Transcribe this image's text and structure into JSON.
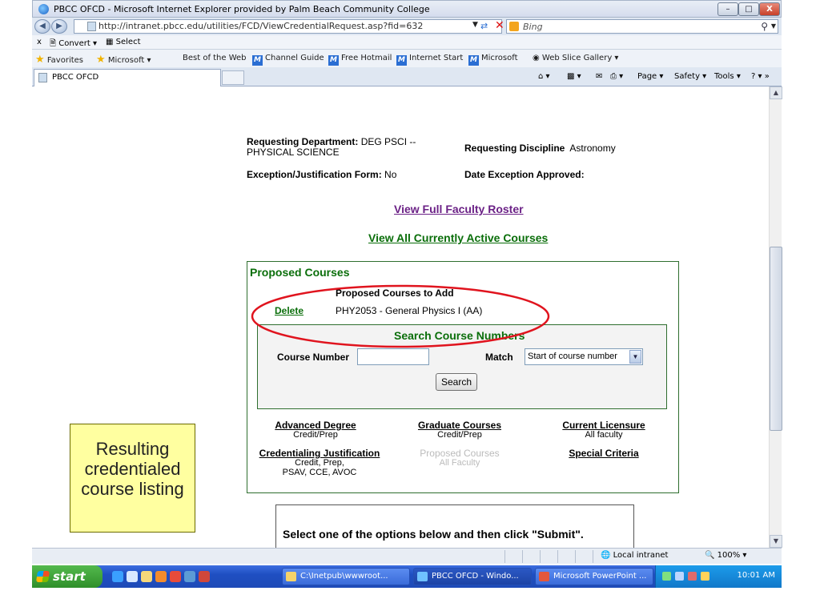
{
  "window": {
    "title": "PBCC OFCD - Microsoft Internet Explorer provided by Palm Beach Community College",
    "minimize": "–",
    "maximize": "□",
    "close": "X"
  },
  "address_bar": {
    "url": "http://intranet.pbcc.edu/utilities/FCD/ViewCredentialRequest.asp?fid=632",
    "search_provider": "Bing"
  },
  "command_bar": {
    "close_x": "x",
    "convert": "Convert",
    "select": "Select"
  },
  "favorites_bar": {
    "favorites": "Favorites",
    "items": [
      "Microsoft",
      "Best of the Web",
      "Channel Guide",
      "Free Hotmail",
      "Internet Start",
      "Microsoft",
      "Web Slice Gallery"
    ]
  },
  "tabs": {
    "active_tab": "PBCC OFCD",
    "tools": {
      "page": "Page",
      "safety": "Safety",
      "tools": "Tools",
      "help": "?"
    }
  },
  "request": {
    "requesting_department_label": "Requesting Department:",
    "requesting_department_value": "DEG PSCI --",
    "requesting_department_value2": "PHYSICAL SCIENCE",
    "requesting_discipline_label": "Requesting Discipline",
    "requesting_discipline_value": "Astronomy",
    "exception_label": "Exception/Justification Form:",
    "exception_value": "No",
    "date_exception_label": "Date Exception Approved:",
    "date_exception_value": ""
  },
  "links": {
    "view_roster": "View Full Faculty Roster",
    "view_courses": "View All Currently Active Courses"
  },
  "proposed": {
    "title": "Proposed Courses",
    "subheading": "Proposed Courses to Add",
    "delete_label": "Delete",
    "course": "PHY2053 - General Physics I (AA)"
  },
  "search": {
    "title": "Search Course Numbers",
    "course_number_label": "Course Number",
    "course_number_value": "",
    "match_label": "Match",
    "match_selected": "Start of course number",
    "search_button": "Search"
  },
  "credentials": [
    {
      "title": "Advanced Degree",
      "sub": [
        "Credit/Prep"
      ],
      "color": "#6b2186"
    },
    {
      "title": "Graduate Courses",
      "sub": [
        "Credit/Prep"
      ],
      "color": "#6b2186"
    },
    {
      "title": "Current Licensure",
      "sub": [
        "All faculty"
      ],
      "color": "#6b2186"
    },
    {
      "title": "Credentialing Justification",
      "sub": [
        "Credit, Prep,",
        "PSAV, CCE, AVOC"
      ],
      "color": "#6b2186"
    },
    {
      "title": "Proposed Courses",
      "sub": [
        "All Faculty"
      ],
      "color": "#bbbbbb"
    },
    {
      "title": "Special Criteria",
      "sub": [],
      "color": "#6b2186"
    }
  ],
  "callout": {
    "lines": [
      "Resulting",
      "credentialed",
      "course listing"
    ],
    "color": "#ffffa0"
  },
  "submit": {
    "instruction": "Select one of the options below and then click \"Submit\"."
  },
  "status_bar": {
    "zone": "Local intranet",
    "zoom": "100%"
  },
  "taskbar": {
    "start": "start",
    "tasks": [
      "C:\\Inetpub\\wwwroot...",
      "PBCC OFCD - Windo...",
      "Microsoft PowerPoint ..."
    ],
    "clock": "10:01 AM"
  }
}
